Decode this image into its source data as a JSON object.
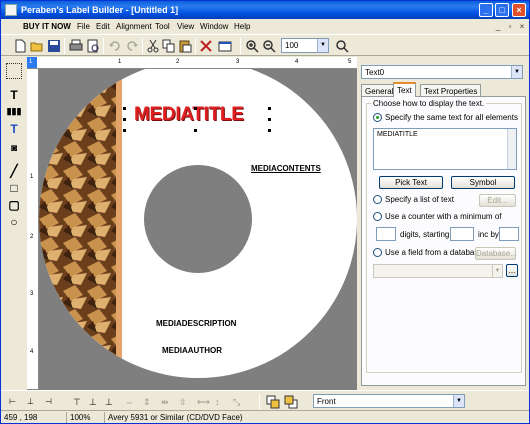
{
  "window": {
    "title": "Peraben's Label Builder - [Untitled 1]",
    "minimize": "_",
    "maximize": "□",
    "close": "×"
  },
  "menu": {
    "items": [
      "BUY IT NOW",
      "File",
      "Edit",
      "Alignment",
      "Tool",
      "View",
      "Window",
      "Help"
    ],
    "mdi_min": "_",
    "mdi_restore": "▫",
    "mdi_close": "×"
  },
  "toolbar": {
    "zoom_value": "100",
    "icons": [
      "new-icon",
      "open-icon",
      "save-icon",
      "print-icon",
      "print-preview-icon",
      "undo-icon",
      "redo-icon",
      "cut-icon",
      "copy-icon",
      "paste-icon",
      "delete-icon",
      "properties-icon",
      "zoom-in-icon",
      "zoom-out-icon",
      "zoom-icon"
    ]
  },
  "rulers": {
    "top": [
      "1",
      "1",
      "2",
      "3",
      "4",
      "5"
    ],
    "left": [
      "1",
      "2",
      "3",
      "4"
    ]
  },
  "label": {
    "title_text": "MEDIATITLE",
    "contents_text": "MEDIACONTENTS",
    "description_text": "MEDIADESCRIPTION",
    "author_text": "MEDIAAUTHOR"
  },
  "panel": {
    "object_selected": "Text0",
    "tabs": [
      "General",
      "Text",
      "Text Properties"
    ],
    "active_tab": "Text",
    "group_label": "Choose how to display the text.",
    "option_same": "Specify the same text for all elements",
    "text_value": "MEDIATITLE",
    "pick_text": "Pick Text",
    "symbol": "Symbol",
    "option_list": "Specify a list of text",
    "edit": "Edit...",
    "option_counter": "Use a counter with a minimum of",
    "digits_starting": "digits, starting at",
    "inc_by": "inc by",
    "option_database": "Use a field from a database",
    "database": "Database...",
    "browse": "..."
  },
  "bottom": {
    "font_value": "Front"
  },
  "status": {
    "coords": "459 , 198",
    "zoom": "100%",
    "template": "Avery 5931 or Similar (CD/DVD Face)"
  },
  "colors": {
    "title_red": "#e02020",
    "canvas_gray": "#7f7f7f",
    "titlebar_blue": "#0a5fd8"
  }
}
